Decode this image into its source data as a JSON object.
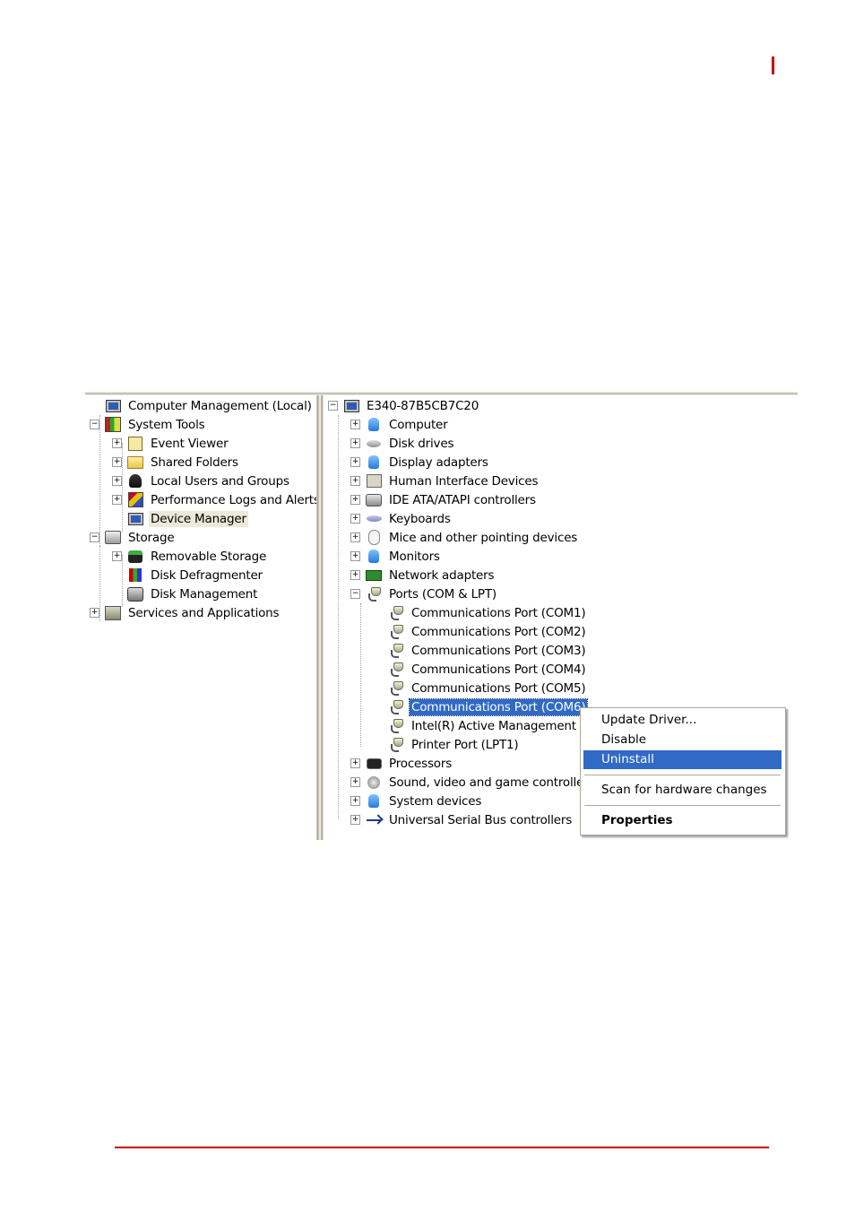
{
  "colors": {
    "accent_red": "#cc0000",
    "selection_blue": "#316ac5",
    "soft_selection": "#ece9d8"
  },
  "left_tree": {
    "items": [
      {
        "label": "Computer Management (Local)",
        "icon": "computer-management-icon",
        "expander": "none",
        "level": 0
      },
      {
        "label": "System Tools",
        "icon": "system-tools-icon",
        "expander": "minus",
        "level": 0
      },
      {
        "label": "Event Viewer",
        "icon": "event-viewer-icon",
        "expander": "plus",
        "level": 1
      },
      {
        "label": "Shared Folders",
        "icon": "shared-folders-icon",
        "expander": "plus",
        "level": 1
      },
      {
        "label": "Local Users and Groups",
        "icon": "local-users-icon",
        "expander": "plus",
        "level": 1
      },
      {
        "label": "Performance Logs and Alerts",
        "icon": "performance-logs-icon",
        "expander": "plus",
        "level": 1
      },
      {
        "label": "Device Manager",
        "icon": "device-manager-icon",
        "expander": "none",
        "level": 1,
        "selected": true
      },
      {
        "label": "Storage",
        "icon": "storage-icon",
        "expander": "minus",
        "level": 0
      },
      {
        "label": "Removable Storage",
        "icon": "removable-storage-icon",
        "expander": "plus",
        "level": 1
      },
      {
        "label": "Disk Defragmenter",
        "icon": "disk-defragmenter-icon",
        "expander": "none",
        "level": 1
      },
      {
        "label": "Disk Management",
        "icon": "disk-management-icon",
        "expander": "none",
        "level": 1
      },
      {
        "label": "Services and Applications",
        "icon": "services-applications-icon",
        "expander": "plus",
        "level": 0
      }
    ]
  },
  "right_tree": {
    "root": "E340-87B5CB7C20",
    "items": [
      {
        "label": "Computer",
        "icon": "computer-icon",
        "expander": "plus",
        "level": 1
      },
      {
        "label": "Disk drives",
        "icon": "disk-drive-icon",
        "expander": "plus",
        "level": 1
      },
      {
        "label": "Display adapters",
        "icon": "display-adapter-icon",
        "expander": "plus",
        "level": 1
      },
      {
        "label": "Human Interface Devices",
        "icon": "hid-icon",
        "expander": "plus",
        "level": 1
      },
      {
        "label": "IDE ATA/ATAPI controllers",
        "icon": "ide-controller-icon",
        "expander": "plus",
        "level": 1
      },
      {
        "label": "Keyboards",
        "icon": "keyboard-icon",
        "expander": "plus",
        "level": 1
      },
      {
        "label": "Mice and other pointing devices",
        "icon": "mouse-icon",
        "expander": "plus",
        "level": 1
      },
      {
        "label": "Monitors",
        "icon": "monitor-icon",
        "expander": "plus",
        "level": 1
      },
      {
        "label": "Network adapters",
        "icon": "network-adapter-icon",
        "expander": "plus",
        "level": 1
      },
      {
        "label": "Ports (COM & LPT)",
        "icon": "port-icon",
        "expander": "minus",
        "level": 1
      },
      {
        "label": "Communications Port (COM1)",
        "icon": "port-icon",
        "expander": "none",
        "level": 2
      },
      {
        "label": "Communications Port (COM2)",
        "icon": "port-icon",
        "expander": "none",
        "level": 2
      },
      {
        "label": "Communications Port (COM3)",
        "icon": "port-icon",
        "expander": "none",
        "level": 2
      },
      {
        "label": "Communications Port (COM4)",
        "icon": "port-icon",
        "expander": "none",
        "level": 2
      },
      {
        "label": "Communications Port (COM5)",
        "icon": "port-icon",
        "expander": "none",
        "level": 2
      },
      {
        "label": "Communications Port (COM6)",
        "icon": "port-icon",
        "expander": "none",
        "level": 2,
        "selected": true
      },
      {
        "label": "Intel(R) Active Management Technology - SOL",
        "icon": "port-icon",
        "expander": "none",
        "level": 2
      },
      {
        "label": "Printer Port (LPT1)",
        "icon": "port-icon",
        "expander": "none",
        "level": 2
      },
      {
        "label": "Processors",
        "icon": "processor-icon",
        "expander": "plus",
        "level": 1
      },
      {
        "label": "Sound, video and game controllers",
        "icon": "sound-icon",
        "expander": "plus",
        "level": 1
      },
      {
        "label": "System devices",
        "icon": "system-devices-icon",
        "expander": "plus",
        "level": 1
      },
      {
        "label": "Universal Serial Bus controllers",
        "icon": "usb-icon",
        "expander": "plus",
        "level": 1
      }
    ]
  },
  "context_menu": {
    "items": [
      {
        "label": "Update Driver...",
        "highlighted": false,
        "bold": false
      },
      {
        "label": "Disable",
        "highlighted": false,
        "bold": false
      },
      {
        "label": "Uninstall",
        "highlighted": true,
        "bold": false
      },
      {
        "separator": true
      },
      {
        "label": "Scan for hardware changes",
        "highlighted": false,
        "bold": false
      },
      {
        "separator": true
      },
      {
        "label": "Properties",
        "highlighted": false,
        "bold": true
      }
    ]
  }
}
